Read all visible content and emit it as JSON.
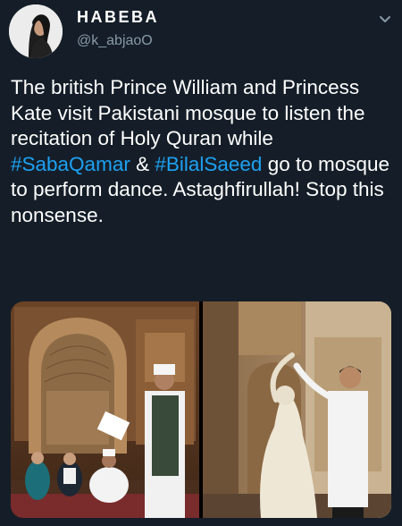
{
  "user": {
    "display_name": "HABEBA",
    "handle": "@k_abjaoO"
  },
  "tweet": {
    "segments": [
      {
        "text": "The british Prince William and Princess Kate visit Pakistani mosque to listen the recitation of Holy Quran while ",
        "type": "text"
      },
      {
        "text": "#SabaQamar",
        "type": "hashtag"
      },
      {
        "text": " & ",
        "type": "text"
      },
      {
        "text": "#BilalSaeed",
        "type": "hashtag"
      },
      {
        "text": " go to mosque to perform dance. Astaghfirullah! Stop this nonsense.",
        "type": "text"
      }
    ]
  },
  "media": {
    "count": 2,
    "photos": [
      {
        "subject": "royal-visit-mosque-photo"
      },
      {
        "subject": "couple-dancing-mosque-photo"
      }
    ]
  },
  "colors": {
    "background": "#151e28",
    "text": "#ffffff",
    "secondary_text": "#8899a6",
    "hashtag": "#1da1f2"
  },
  "icons": {
    "options": "chevron-down-icon",
    "avatar": "profile-picture"
  }
}
